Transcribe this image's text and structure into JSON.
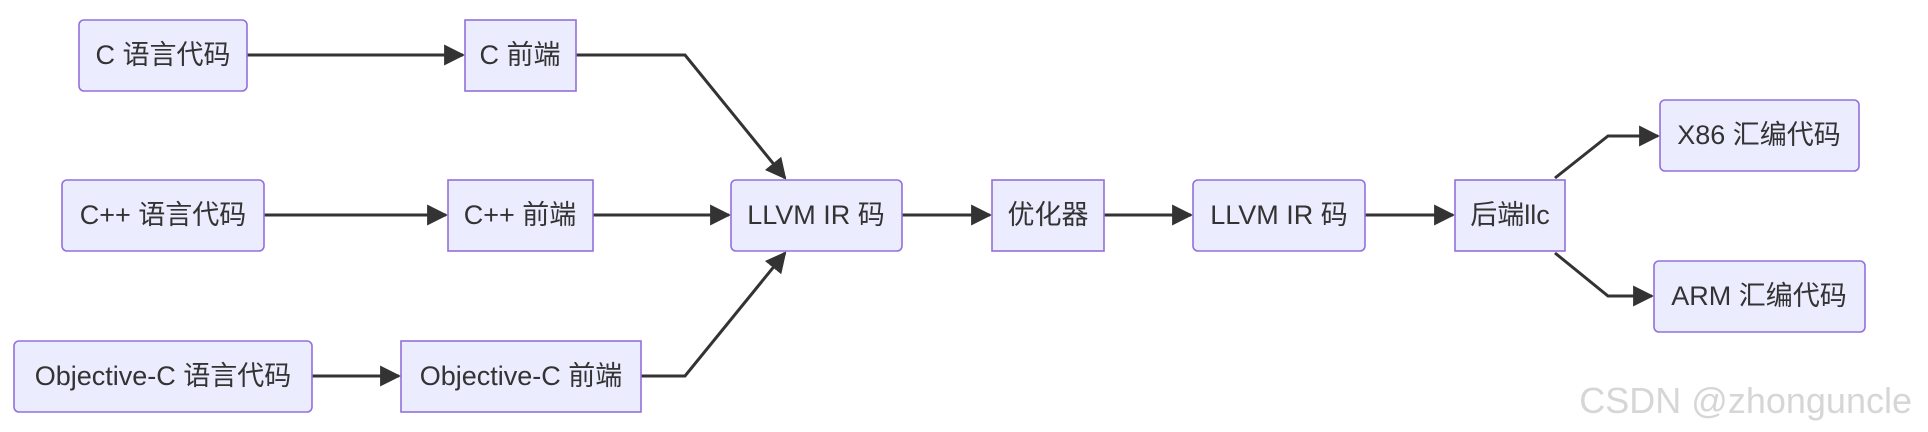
{
  "nodes": {
    "c_source": "C 语言代码",
    "cpp_source": "C++ 语言代码",
    "objc_source": "Objective-C 语言代码",
    "c_frontend": "C 前端",
    "cpp_frontend": "C++ 前端",
    "objc_frontend": "Objective-C 前端",
    "llvm_ir_1": "LLVM IR 码",
    "optimizer": "优化器",
    "llvm_ir_2": "LLVM IR 码",
    "backend": "后端llc",
    "x86_asm": "X86 汇编代码",
    "arm_asm": "ARM 汇编代码"
  },
  "edges": [
    [
      "c_source",
      "c_frontend"
    ],
    [
      "cpp_source",
      "cpp_frontend"
    ],
    [
      "objc_source",
      "objc_frontend"
    ],
    [
      "c_frontend",
      "llvm_ir_1"
    ],
    [
      "cpp_frontend",
      "llvm_ir_1"
    ],
    [
      "objc_frontend",
      "llvm_ir_1"
    ],
    [
      "llvm_ir_1",
      "optimizer"
    ],
    [
      "optimizer",
      "llvm_ir_2"
    ],
    [
      "llvm_ir_2",
      "backend"
    ],
    [
      "backend",
      "x86_asm"
    ],
    [
      "backend",
      "arm_asm"
    ]
  ],
  "colors": {
    "node_fill": "#ECECFF",
    "node_border": "#9370DB",
    "edge": "#333333",
    "text": "#333333"
  },
  "watermark": "CSDN @zhonguncle"
}
